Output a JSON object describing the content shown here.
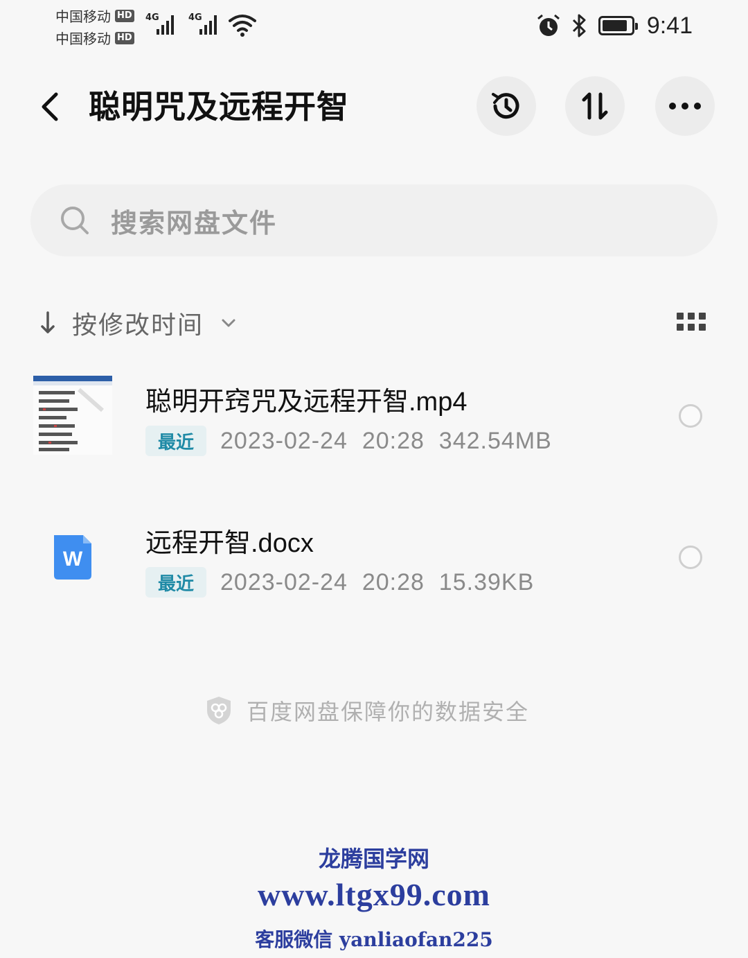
{
  "status_bar": {
    "carrier1": "中国移动",
    "carrier2": "中国移动",
    "hd_badge": "HD",
    "network1": "4G",
    "network2": "4G",
    "time": "9:41",
    "icons": [
      "alarm-icon",
      "bluetooth-icon",
      "battery-icon",
      "wifi-icon",
      "signal-icon"
    ]
  },
  "header": {
    "title": "聪明咒及远程开智",
    "back_icon": "chevron-left-icon",
    "history_icon": "history-icon",
    "sort_icon": "transfer-icon",
    "more_icon": "more-icon"
  },
  "search": {
    "placeholder": "搜索网盘文件",
    "icon": "search-icon"
  },
  "sort": {
    "label": "按修改时间",
    "icon": "arrow-down-icon",
    "dropdown_icon": "chevron-down-icon",
    "view_icon": "grid-view-icon"
  },
  "files": [
    {
      "name": "聪明开窍咒及远程开智.mp4",
      "badge": "最近",
      "meta": "2023-02-24  20:28  342.54MB",
      "thumb": "video-thumbnail"
    },
    {
      "name": "远程开智.docx",
      "badge": "最近",
      "meta": "2023-02-24  20:28  15.39KB",
      "thumb": "word-icon",
      "thumb_letter": "W"
    }
  ],
  "footer": {
    "security_text": "百度网盘保障你的数据安全",
    "security_icon": "shield-icon"
  },
  "watermark": {
    "line1": "龙腾国学网",
    "line2": "www.ltgx99.com",
    "line3": "客服微信 yanliaofan225"
  },
  "colors": {
    "background": "#f7f7f7",
    "badge_text": "#1f8aa6",
    "badge_bg": "#e6f0f2",
    "word_blue": "#3f8ef0",
    "watermark": "#2c3e9e"
  }
}
